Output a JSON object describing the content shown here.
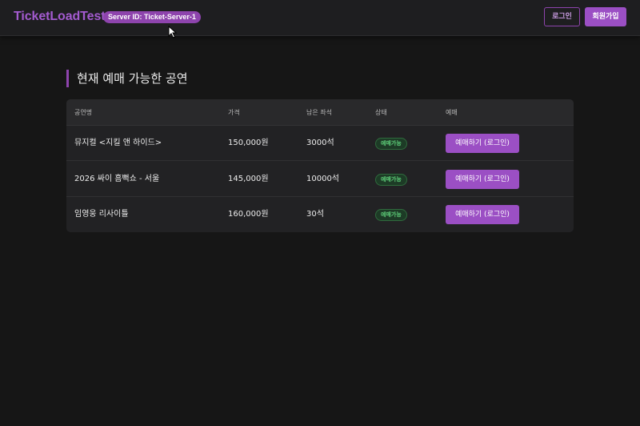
{
  "header": {
    "brand": "TicketLoadTest",
    "server_badge": "Server ID: Ticket-Server-1",
    "login_label": "로그인",
    "signup_label": "회원가입"
  },
  "main": {
    "section_title": "현재 예매 가능한 공연",
    "table": {
      "columns": [
        "공연명",
        "가격",
        "남은 좌석",
        "상태",
        "예매"
      ],
      "rows": [
        {
          "name": "뮤지컬 <지킬 앤 하이드>",
          "price": "150,000원",
          "seats": "3000석",
          "status": "예매가능",
          "action": "예매하기 (로그인)"
        },
        {
          "name": "2026 싸이 흠뻑쇼 - 서울",
          "price": "145,000원",
          "seats": "10000석",
          "status": "예매가능",
          "action": "예매하기 (로그인)"
        },
        {
          "name": "임영웅 리사이틀",
          "price": "160,000원",
          "seats": "30석",
          "status": "예매가능",
          "action": "예매하기 (로그인)"
        }
      ]
    }
  },
  "colors": {
    "accent": "#8e44ad",
    "button": "#9b4fc4",
    "status_green": "#5fd07a",
    "background": "#161616"
  },
  "icons": {
    "cursor": "mouse-pointer-icon"
  }
}
